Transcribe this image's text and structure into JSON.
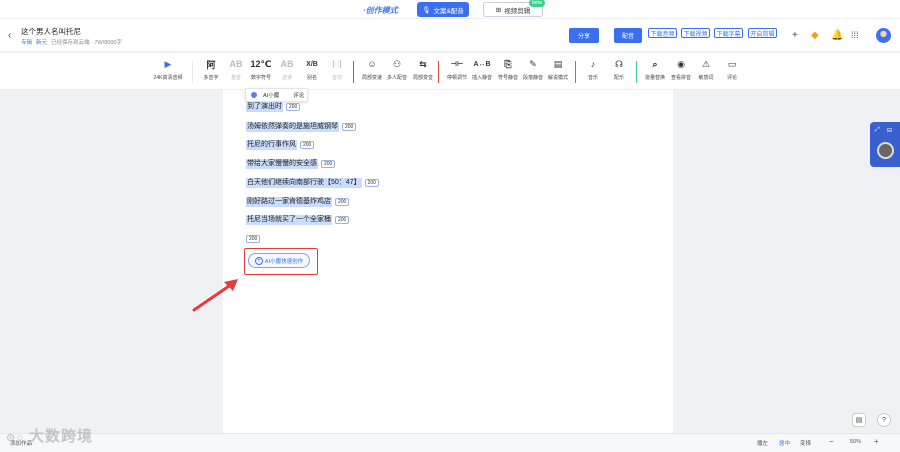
{
  "top": {
    "mode_title": "·创作模式",
    "copy_dub_label": "文案&配音",
    "video_edit_label": "视频剪辑",
    "beta_label": "beta"
  },
  "header": {
    "title": "这个男人名叫托尼",
    "crumb1": "专辑",
    "crumb2": "新元",
    "saved_text": "已经保存到云端 · 7W/8000字",
    "buttons": {
      "share": "分享",
      "dub": "配音",
      "download_audio": "下载音频",
      "download_video": "下载视频",
      "download_subtitle": "下载字幕",
      "save_clip": "开启剪辑"
    }
  },
  "toolbar": {
    "tools": [
      {
        "icon": "▶",
        "label": "24K高清音频"
      },
      {
        "icon": "阿",
        "label": "多音字"
      },
      {
        "icon": "AB",
        "label": "重音"
      },
      {
        "icon": "12℃",
        "label": "数字符号"
      },
      {
        "icon": "AB",
        "label": "连读"
      },
      {
        "icon": "X/B",
        "label": "别名"
      },
      {
        "icon": "[○]",
        "label": "音效"
      },
      {
        "icon": "☺",
        "label": "局部变速"
      },
      {
        "icon": "⚇",
        "label": "多人配音"
      },
      {
        "icon": "⇆",
        "label": "局部变音"
      },
      {
        "icon": "⊣⊢",
        "label": "停顿调节"
      },
      {
        "icon": "A↔B",
        "label": "插入静音"
      },
      {
        "icon": "⎘",
        "label": "符号静音"
      },
      {
        "icon": "✎",
        "label": "段落静音"
      },
      {
        "icon": "▤",
        "label": "解说模式"
      },
      {
        "icon": "♪",
        "label": "音乐"
      },
      {
        "icon": "☊",
        "label": "配乐"
      },
      {
        "icon": "⌕",
        "label": "批量替换"
      },
      {
        "icon": "◉",
        "label": "查看拼音"
      },
      {
        "icon": "⚠",
        "label": "敏感词"
      },
      {
        "icon": "▭",
        "label": "评论"
      }
    ]
  },
  "editor": {
    "popup": {
      "ai_label": "AI小魔",
      "comment_label": "评论"
    },
    "lines": [
      {
        "text": "到了演出时",
        "tag": "200"
      },
      {
        "text": "汤姆依然弹奏的是施坦威钢琴",
        "tag": "200"
      },
      {
        "text": "托尼的行事作风",
        "tag": "200"
      },
      {
        "text": "带给大家慢慢的安全感",
        "tag": "200"
      },
      {
        "text": "白天他们继续向南部行驶【50：47】",
        "tag": "200"
      },
      {
        "text": "刚好路过一家肯德基炸鸡店",
        "tag": "200"
      },
      {
        "text": "托尼当场就买了一个全家桶",
        "tag": "200"
      }
    ],
    "empty_tag": "200",
    "quick_action": "AI小魔快速创作"
  },
  "bottom": {
    "left_label": "添加作品",
    "play_left": "播左",
    "center": "居中",
    "play_right": "变择",
    "zoom": "50%",
    "minus": "−",
    "plus": "+"
  },
  "watermark": "大数跨境",
  "colors": {
    "accent": "#3a70f0",
    "highlight": "#c9dcfb",
    "annotation": "#e53b3b"
  }
}
